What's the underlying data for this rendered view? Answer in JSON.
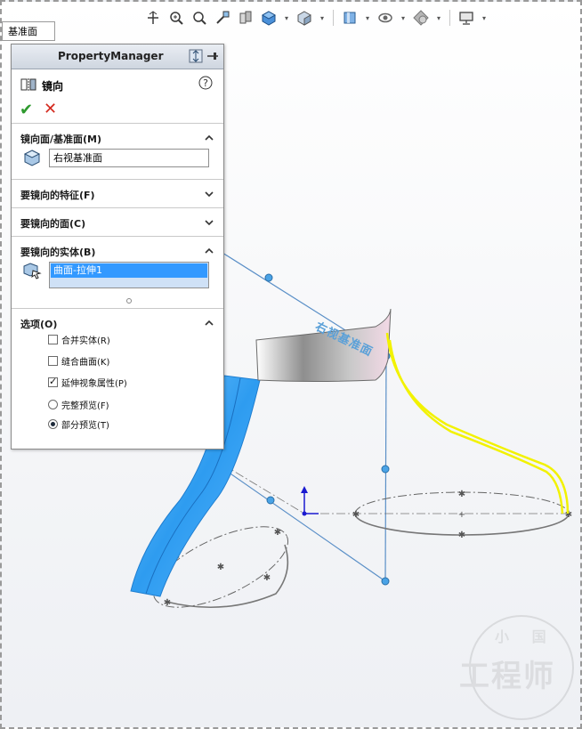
{
  "tree_tab": {
    "label": "基准面"
  },
  "pm": {
    "header_title": "PropertyManager",
    "feature_name": "镜向",
    "help_label": "?",
    "ok_label": "✔",
    "cancel_label": "✕",
    "groups": {
      "mirror_plane": {
        "title": "镜向面/基准面(M)",
        "value": "右视基准面"
      },
      "features": {
        "title": "要镜向的特征(F)"
      },
      "faces": {
        "title": "要镜向的面(C)"
      },
      "bodies": {
        "title": "要镜向的实体(B)",
        "items": [
          "曲面-拉伸1"
        ]
      },
      "options": {
        "title": "选项(O)",
        "merge_solids": "合并实体(R)",
        "knit_surfaces": "缝合曲面(K)",
        "propagate_visual": "延伸视象属性(P)",
        "full_preview": "完整预览(F)",
        "partial_preview": "部分预览(T)"
      }
    }
  },
  "viewport": {
    "plane_label": "右视基准面"
  },
  "watermark": {
    "line1": "小 国",
    "line2": "工程师"
  },
  "colors": {
    "accent_blue": "#3399ff",
    "surface_blue": "#2e9cf0",
    "preview_yellow": "#f2f200",
    "ok_green": "#2e9a2e",
    "cancel_red": "#d42a1f"
  }
}
